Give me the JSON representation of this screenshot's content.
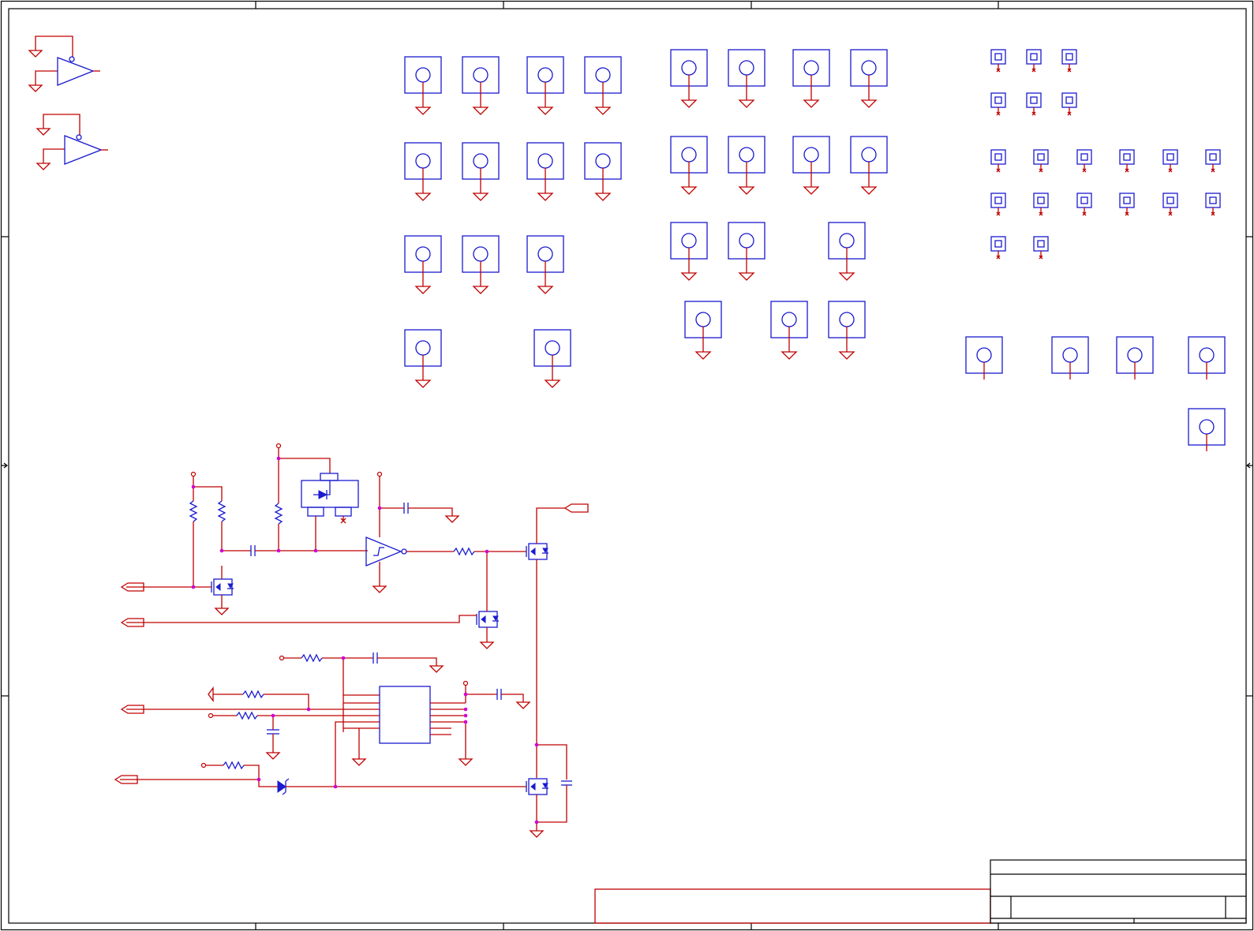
{
  "diagram": {
    "type": "schematic",
    "colors": {
      "wire": "#c00000",
      "component": "#1a1ad0",
      "junction": "#d000d0",
      "frame": "#000000"
    },
    "symbols": [
      "inverter",
      "mounting-hole",
      "test-point",
      "ground",
      "resistor",
      "capacitor",
      "mosfet",
      "schmitt-trigger-buffer",
      "ic-package",
      "zener-diode",
      "off-page-connector",
      "power-port"
    ],
    "title_block": {
      "sheet_cell": "",
      "title": "",
      "document_number": "",
      "revision": ""
    }
  }
}
